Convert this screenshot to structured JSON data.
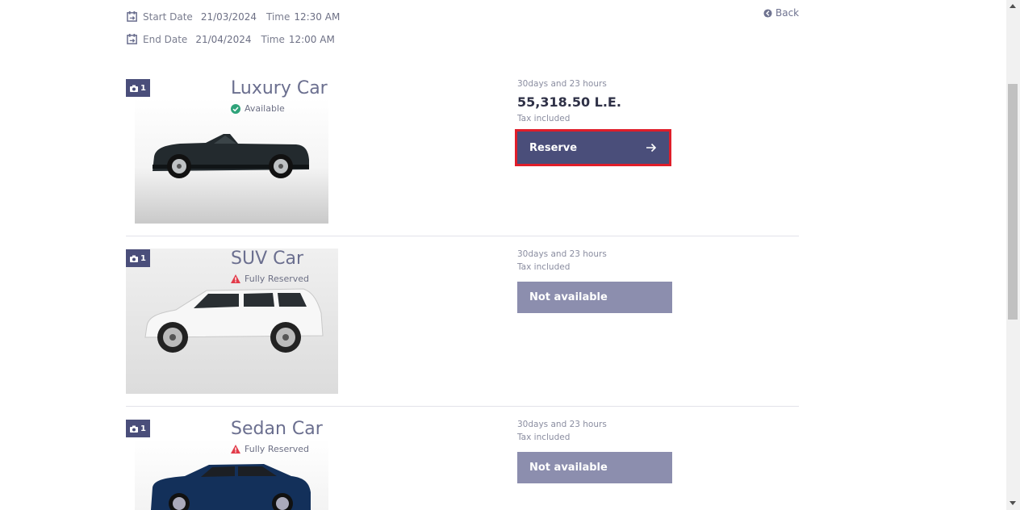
{
  "dates": {
    "start_label": "Start Date",
    "start_value": "21/03/2024",
    "end_label": "End Date",
    "end_value": "21/04/2024",
    "time_label": "Time",
    "start_time": "12:30 AM",
    "end_time": "12:00 AM"
  },
  "back_label": "Back",
  "cars": [
    {
      "badge_count": "1",
      "title": "Luxury Car",
      "status": "Available",
      "duration": "30days and 23 hours",
      "price": "55,318.50 L.E.",
      "tax": "Tax included",
      "button": "Reserve"
    },
    {
      "badge_count": "1",
      "title": "SUV Car",
      "status": "Fully Reserved",
      "duration": "30days and 23 hours",
      "tax": "Tax included",
      "button": "Not available"
    },
    {
      "badge_count": "1",
      "title": "Sedan Car",
      "status": "Fully Reserved",
      "duration": "30days and 23 hours",
      "tax": "Tax included",
      "button": "Not available"
    }
  ],
  "colors": {
    "primary": "#4a4e7a",
    "disabled": "#8c8eae",
    "available": "#2fa37a",
    "reserved": "#e23b4a",
    "highlight": "#e01e2a"
  }
}
